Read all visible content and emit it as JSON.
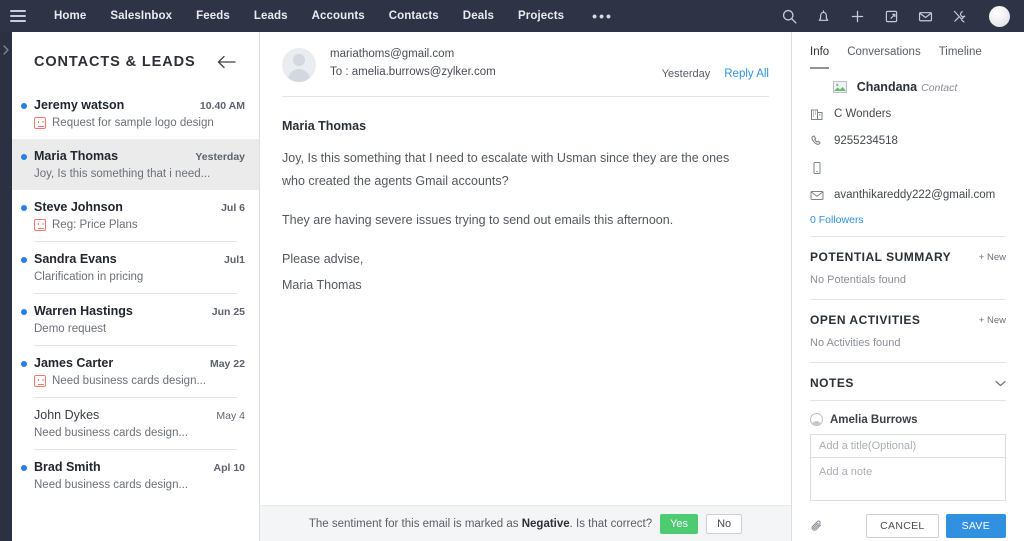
{
  "topnav": {
    "menu_icon": "hamburger-icon",
    "links": [
      "Home",
      "SalesInbox",
      "Feeds",
      "Leads",
      "Accounts",
      "Contacts",
      "Deals",
      "Projects"
    ],
    "more_label": "•••",
    "icons": [
      "search-icon",
      "bell-icon",
      "plus-icon",
      "notes-icon",
      "mail-icon",
      "tools-icon"
    ],
    "background": "#2e3446"
  },
  "rail": {
    "expand_icon": "chevron-right-icon"
  },
  "list": {
    "title": "CONTACTS & LEADS",
    "back_icon": "arrow-left-icon",
    "items": [
      {
        "name": "Jeremy watson",
        "date": "10.40 AM",
        "subject": "Request for sample logo design",
        "unread": true,
        "sentiment": true
      },
      {
        "name": "Maria Thomas",
        "date": "Yesterday",
        "subject": "Joy, Is this something that i need...",
        "unread": true,
        "sentiment": false,
        "selected": true
      },
      {
        "name": "Steve Johnson",
        "date": "Jul 6",
        "subject": "Reg: Price Plans",
        "unread": true,
        "sentiment": true
      },
      {
        "name": "Sandra Evans",
        "date": "Jul1",
        "subject": "Clarification in pricing",
        "unread": true,
        "sentiment": false
      },
      {
        "name": "Warren Hastings",
        "date": "Jun 25",
        "subject": "Demo request",
        "unread": true,
        "sentiment": false
      },
      {
        "name": "James Carter",
        "date": "May 22",
        "subject": "Need business cards design...",
        "unread": true,
        "sentiment": true
      },
      {
        "name": "John Dykes",
        "date": "May 4",
        "subject": "Need business cards design...",
        "unread": false,
        "sentiment": false
      },
      {
        "name": "Brad Smith",
        "date": "Apl 10",
        "subject": "Need business cards design...",
        "unread": true,
        "sentiment": false
      }
    ]
  },
  "mail": {
    "from": "mariathoms@gmail.com",
    "to": "To : amelia.burrows@zylker.com",
    "when": "Yesterday",
    "reply_all": "Reply All",
    "sender_name": "Maria Thomas",
    "paragraphs": [
      "Joy, Is this something that I need to escalate with Usman since they are the ones who created the agents Gmail accounts?",
      "They are having severe issues trying to send out emails this afternoon."
    ],
    "signoff": "Please advise,",
    "signature": "Maria Thomas",
    "sentiment": {
      "prefix": "The sentiment for this email is marked as ",
      "value": "Negative",
      "suffix": ". Is that correct?",
      "yes_label": "Yes",
      "no_label": "No",
      "yes_color": "#4ecb71"
    }
  },
  "info": {
    "tabs": [
      {
        "label": "Info",
        "active": true
      },
      {
        "label": "Conversations",
        "active": false
      },
      {
        "label": "Timeline",
        "active": false
      }
    ],
    "contact": {
      "name": "Chandana",
      "type": "Contact",
      "company": "C Wonders",
      "phone": "9255234518",
      "mobile": "",
      "email": "avanthikareddy222@gmail.com",
      "followers": "0 Followers"
    },
    "potential": {
      "title": "POTENTIAL SUMMARY",
      "new_label": "+ New",
      "empty": "No Potentials found"
    },
    "activities": {
      "title": "OPEN ACTIVITIES",
      "new_label": "+ New",
      "empty": "No Activities found"
    },
    "notes": {
      "title": "NOTES",
      "collapse_icon": "chevron-down-icon",
      "user": "Amelia Burrows",
      "title_placeholder": "Add a title(Optional)",
      "body_placeholder": "Add a note",
      "title_value": "",
      "body_value": "",
      "attach_icon": "paperclip-icon",
      "cancel_label": "CANCEL",
      "save_label": "SAVE",
      "save_color": "#3191e0"
    }
  }
}
